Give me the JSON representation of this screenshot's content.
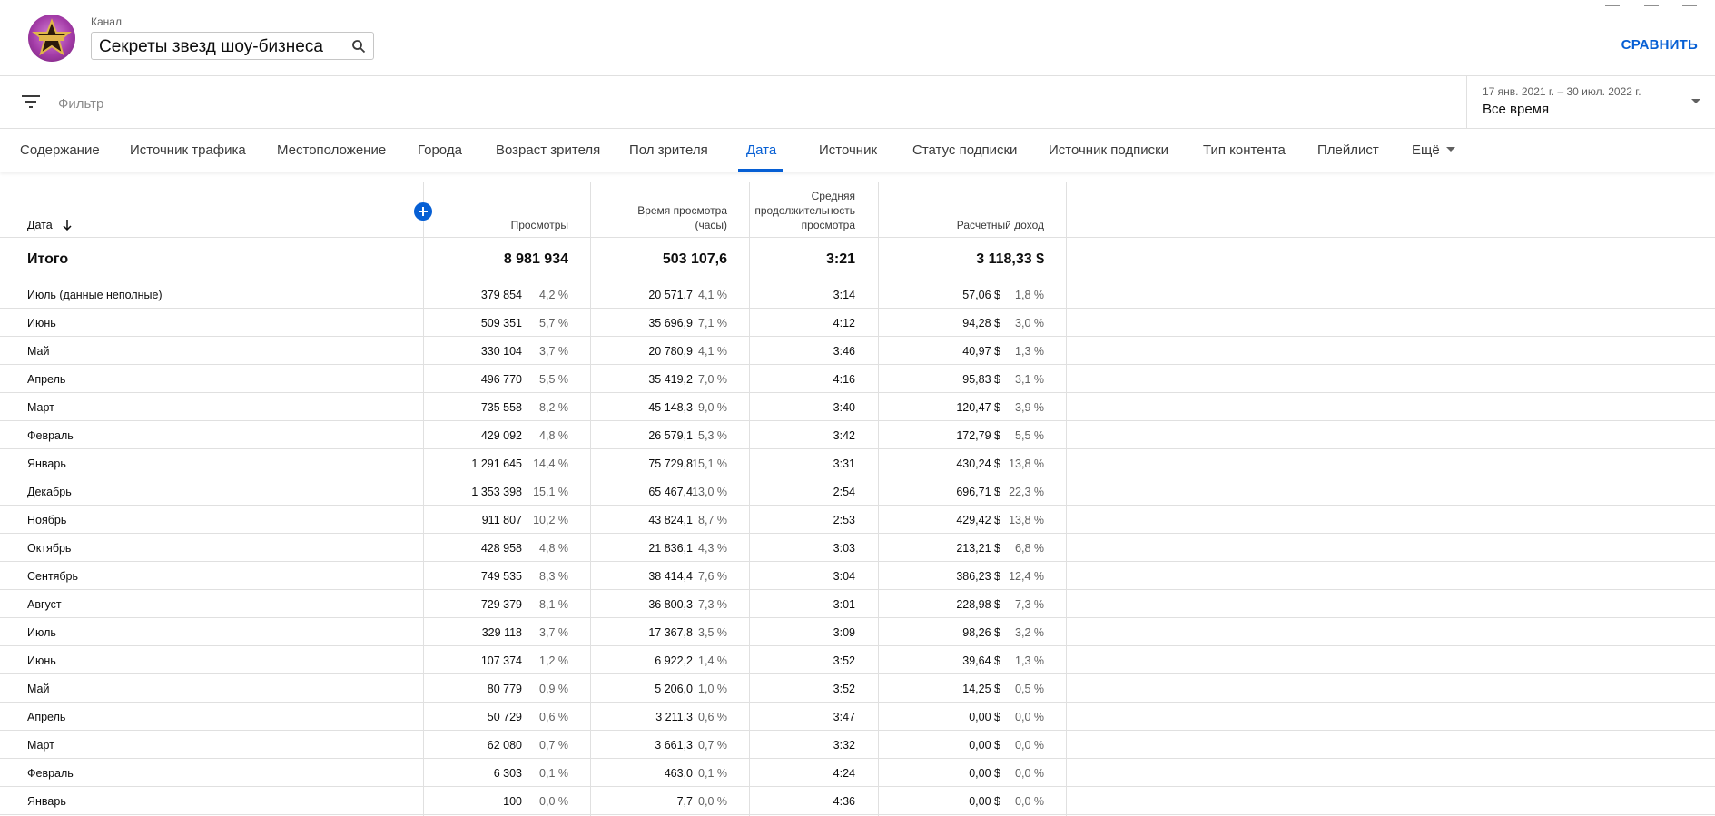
{
  "header": {
    "channel_label": "Канал",
    "channel_name": "Секреты звезд шоу-бизнеса",
    "compare_label": "СРАВНИТЬ"
  },
  "filterbar": {
    "filter_placeholder": "Фильтр",
    "date_range_dates": "17 янв. 2021 г. – 30 июл. 2022 г.",
    "date_range_value": "Все время"
  },
  "tabs": [
    {
      "label": "Содержание"
    },
    {
      "label": "Источник трафика"
    },
    {
      "label": "Местоположение"
    },
    {
      "label": "Города"
    },
    {
      "label": "Возраст зрителя"
    },
    {
      "label": "Пол зрителя"
    },
    {
      "label": "Дата",
      "active": true
    },
    {
      "label": "Источник"
    },
    {
      "label": "Статус подписки"
    },
    {
      "label": "Источник подписки"
    },
    {
      "label": "Тип контента"
    },
    {
      "label": "Плейлист"
    },
    {
      "label": "Ещё"
    }
  ],
  "table": {
    "columns": {
      "date": "Дата",
      "views": "Просмотры",
      "watch_time_1": "Время просмотра",
      "watch_time_2": "(часы)",
      "avg_1": "Средняя",
      "avg_2": "продолжительность",
      "avg_3": "просмотра",
      "revenue": "Расчетный доход"
    },
    "total": {
      "label": "Итого",
      "views": "8 981 934",
      "watch_time": "503 107,6",
      "avg_duration": "3:21",
      "revenue": "3 118,33 $"
    },
    "rows": [
      {
        "label": "Июль (данные неполные)",
        "views": "379 854",
        "views_pct": "4,2 %",
        "watch": "20 571,7",
        "watch_pct": "4,1 %",
        "avg": "3:14",
        "revenue": "57,06 $",
        "revenue_pct": "1,8 %"
      },
      {
        "label": "Июнь",
        "views": "509 351",
        "views_pct": "5,7 %",
        "watch": "35 696,9",
        "watch_pct": "7,1 %",
        "avg": "4:12",
        "revenue": "94,28 $",
        "revenue_pct": "3,0 %"
      },
      {
        "label": "Май",
        "views": "330 104",
        "views_pct": "3,7 %",
        "watch": "20 780,9",
        "watch_pct": "4,1 %",
        "avg": "3:46",
        "revenue": "40,97 $",
        "revenue_pct": "1,3 %"
      },
      {
        "label": "Апрель",
        "views": "496 770",
        "views_pct": "5,5 %",
        "watch": "35 419,2",
        "watch_pct": "7,0 %",
        "avg": "4:16",
        "revenue": "95,83 $",
        "revenue_pct": "3,1 %"
      },
      {
        "label": "Март",
        "views": "735 558",
        "views_pct": "8,2 %",
        "watch": "45 148,3",
        "watch_pct": "9,0 %",
        "avg": "3:40",
        "revenue": "120,47 $",
        "revenue_pct": "3,9 %"
      },
      {
        "label": "Февраль",
        "views": "429 092",
        "views_pct": "4,8 %",
        "watch": "26 579,1",
        "watch_pct": "5,3 %",
        "avg": "3:42",
        "revenue": "172,79 $",
        "revenue_pct": "5,5 %"
      },
      {
        "label": "Январь",
        "views": "1 291 645",
        "views_pct": "14,4 %",
        "watch": "75 729,8",
        "watch_pct": "15,1 %",
        "avg": "3:31",
        "revenue": "430,24 $",
        "revenue_pct": "13,8 %"
      },
      {
        "label": "Декабрь",
        "views": "1 353 398",
        "views_pct": "15,1 %",
        "watch": "65 467,4",
        "watch_pct": "13,0 %",
        "avg": "2:54",
        "revenue": "696,71 $",
        "revenue_pct": "22,3 %"
      },
      {
        "label": "Ноябрь",
        "views": "911 807",
        "views_pct": "10,2 %",
        "watch": "43 824,1",
        "watch_pct": "8,7 %",
        "avg": "2:53",
        "revenue": "429,42 $",
        "revenue_pct": "13,8 %"
      },
      {
        "label": "Октябрь",
        "views": "428 958",
        "views_pct": "4,8 %",
        "watch": "21 836,1",
        "watch_pct": "4,3 %",
        "avg": "3:03",
        "revenue": "213,21 $",
        "revenue_pct": "6,8 %"
      },
      {
        "label": "Сентябрь",
        "views": "749 535",
        "views_pct": "8,3 %",
        "watch": "38 414,4",
        "watch_pct": "7,6 %",
        "avg": "3:04",
        "revenue": "386,23 $",
        "revenue_pct": "12,4 %"
      },
      {
        "label": "Август",
        "views": "729 379",
        "views_pct": "8,1 %",
        "watch": "36 800,3",
        "watch_pct": "7,3 %",
        "avg": "3:01",
        "revenue": "228,98 $",
        "revenue_pct": "7,3 %"
      },
      {
        "label": "Июль",
        "views": "329 118",
        "views_pct": "3,7 %",
        "watch": "17 367,8",
        "watch_pct": "3,5 %",
        "avg": "3:09",
        "revenue": "98,26 $",
        "revenue_pct": "3,2 %"
      },
      {
        "label": "Июнь",
        "views": "107 374",
        "views_pct": "1,2 %",
        "watch": "6 922,2",
        "watch_pct": "1,4 %",
        "avg": "3:52",
        "revenue": "39,64 $",
        "revenue_pct": "1,3 %"
      },
      {
        "label": "Май",
        "views": "80 779",
        "views_pct": "0,9 %",
        "watch": "5 206,0",
        "watch_pct": "1,0 %",
        "avg": "3:52",
        "revenue": "14,25 $",
        "revenue_pct": "0,5 %"
      },
      {
        "label": "Апрель",
        "views": "50 729",
        "views_pct": "0,6 %",
        "watch": "3 211,3",
        "watch_pct": "0,6 %",
        "avg": "3:47",
        "revenue": "0,00 $",
        "revenue_pct": "0,0 %"
      },
      {
        "label": "Март",
        "views": "62 080",
        "views_pct": "0,7 %",
        "watch": "3 661,3",
        "watch_pct": "0,7 %",
        "avg": "3:32",
        "revenue": "0,00 $",
        "revenue_pct": "0,0 %"
      },
      {
        "label": "Февраль",
        "views": "6 303",
        "views_pct": "0,1 %",
        "watch": "463,0",
        "watch_pct": "0,1 %",
        "avg": "4:24",
        "revenue": "0,00 $",
        "revenue_pct": "0,0 %"
      },
      {
        "label": "Январь",
        "views": "100",
        "views_pct": "0,0 %",
        "watch": "7,7",
        "watch_pct": "0,0 %",
        "avg": "4:36",
        "revenue": "0,00 $",
        "revenue_pct": "0,0 %"
      }
    ]
  },
  "colors": {
    "accent": "#065fd4",
    "border": "#e0e0e0",
    "text": "#0d0d0d",
    "secondary_text": "#606060"
  },
  "icons": {
    "avatar": "star-logo-avatar",
    "search": "search-icon",
    "filter": "filter-lines-icon",
    "sort": "arrow-down-icon",
    "add": "plus-circle-icon",
    "date_caret": "caret-down-icon"
  }
}
